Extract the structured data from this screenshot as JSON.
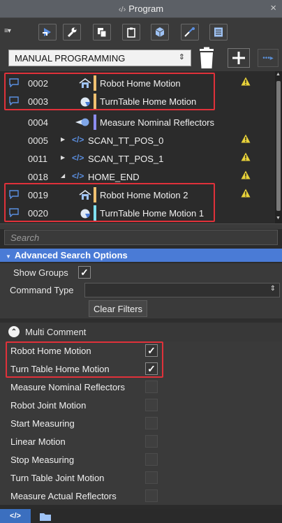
{
  "window": {
    "title": "Program",
    "close_glyph": "×"
  },
  "toolbar": {
    "menu_glyph": "≡▾",
    "buttons": [
      "run-icon",
      "wrench-icon",
      "copy-icon",
      "clipboard-icon",
      "cube-icon",
      "measure-icon",
      "list-icon"
    ]
  },
  "program": {
    "selected": "MANUAL PROGRAMMING",
    "select_arrows": "⇕",
    "add_glyph": "+",
    "more_glyph": "•••▸"
  },
  "tree": {
    "rows": [
      {
        "num": "0002",
        "label": "Robot Home Motion",
        "type": "robot",
        "comment": true,
        "warn": true,
        "stripe": "#f0c070"
      },
      {
        "num": "0003",
        "label": "TurnTable Home Motion",
        "type": "turntable",
        "comment": true,
        "warn": false,
        "stripe": "#f0c070"
      },
      {
        "num": "0004",
        "label": "Measure Nominal Reflectors",
        "type": "measure",
        "comment": false,
        "warn": false,
        "stripe": "#8c8cf0"
      },
      {
        "num": "0005",
        "label": "SCAN_TT_POS_0",
        "type": "group",
        "expander": "▶",
        "comment": false,
        "warn": true
      },
      {
        "num": "0011",
        "label": "SCAN_TT_POS_1",
        "type": "group",
        "expander": "▶",
        "comment": false,
        "warn": true
      },
      {
        "num": "0018",
        "label": "HOME_END",
        "type": "group",
        "expander": "◢",
        "comment": false,
        "warn": true
      },
      {
        "num": "0019",
        "label": "Robot Home Motion 2",
        "type": "robot",
        "comment": true,
        "warn": true,
        "stripe": "#f0c070"
      },
      {
        "num": "0020",
        "label": "TurnTable Home Motion 1",
        "type": "turntable",
        "comment": true,
        "warn": false,
        "stripe": "#7fe0f0"
      }
    ],
    "code_glyph": "</>",
    "scroll_up": "▲",
    "scroll_down": "▼"
  },
  "search": {
    "placeholder": "Search",
    "value": ""
  },
  "advanced": {
    "header": "Advanced Search Options",
    "header_glyph": "▼",
    "show_groups_label": "Show Groups",
    "show_groups_checked": true,
    "check_glyph": "✓",
    "command_type_label": "Command Type",
    "command_type_value": "",
    "command_arrows": "⇕",
    "clear_filters": "Clear Filters"
  },
  "multi_comment": {
    "header": "Multi Comment",
    "header_glyph": "⌃",
    "items": [
      {
        "label": "Robot Home Motion",
        "checked": true
      },
      {
        "label": "Turn Table Home Motion",
        "checked": true
      },
      {
        "label": "Measure Nominal Reflectors",
        "checked": false
      },
      {
        "label": "Robot Joint Motion",
        "checked": false
      },
      {
        "label": "Start Measuring",
        "checked": false
      },
      {
        "label": "Linear Motion",
        "checked": false
      },
      {
        "label": "Stop Measuring",
        "checked": false
      },
      {
        "label": "Turn Table Joint Motion",
        "checked": false
      },
      {
        "label": "Measure Actual Reflectors",
        "checked": false
      }
    ]
  },
  "statusbar": {
    "code_tab": "</>"
  },
  "colors": {
    "accent": "#4a7bd6",
    "highlight_box": "#e0313a",
    "warning": "#e8d23a",
    "comment_icon": "#5b8fe0"
  }
}
